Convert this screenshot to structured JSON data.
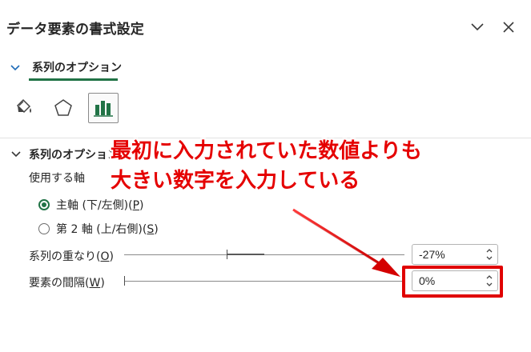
{
  "pane": {
    "title": "データ要素の書式設定"
  },
  "section_tab": {
    "label": "系列のオプション"
  },
  "icon_tabs": [
    {
      "name": "fill-line-icon"
    },
    {
      "name": "effects-pentagon-icon"
    },
    {
      "name": "series-options-chart-icon",
      "active": true
    }
  ],
  "group": {
    "label": "系列のオプション"
  },
  "axis": {
    "label": "使用する軸",
    "primary_text": "主軸 (下/左側)(",
    "primary_key": "P",
    "primary_end": ")",
    "secondary_text": "第 2 軸 (上/右側)(",
    "secondary_key": "S",
    "secondary_end": ")",
    "selected": "primary"
  },
  "overlap": {
    "label_text": "系列の重なり(",
    "label_key": "O",
    "label_end": ")",
    "value": "-27%",
    "percent": -27
  },
  "gap": {
    "label_text": "要素の間隔(",
    "label_key": "W",
    "label_end": ")",
    "value": "0%",
    "percent": 0
  },
  "annotation": {
    "line1": "最初に入力されていた数値よりも",
    "line2": "大きい数字を入力している",
    "color": "#e50000"
  },
  "colors": {
    "accent": "#217346",
    "annotation_red": "#e00000"
  }
}
